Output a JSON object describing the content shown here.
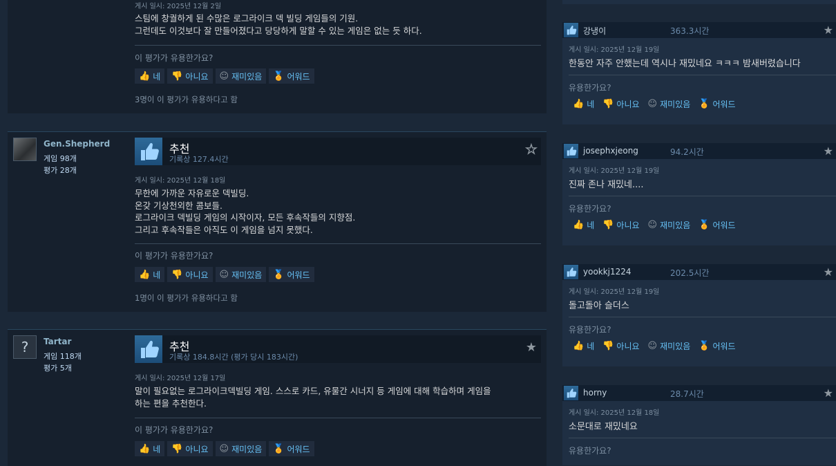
{
  "reviews": [
    {
      "posted": "게시 일시: 2025년 12월 2일",
      "body": [
        "스팀에 창궐하게 된 수많은 로그라이크 덱 빌딩 게임들의 기원.",
        "그런데도 이것보다 잘 만들어졌다고 당당하게 말할 수 있는 게임은 없는 듯 하다."
      ],
      "helpful_q": "이 평가가 유용한가요?",
      "buttons": {
        "yes": "네",
        "no": "아니요",
        "funny": "재미있음",
        "award": "어워드"
      },
      "helpful_count": "3명이 이 평가가 유용하다고 함"
    },
    {
      "author": {
        "name": "Gen.Shepherd",
        "games": "게임 98개",
        "reviews": "평가 28개"
      },
      "verdict": "추천",
      "hours": "기록상 127.4시간",
      "posted": "게시 일시: 2025년 12월 18일",
      "body": [
        "무한에 가까운 자유로운 덱빌딩.",
        "온갖 기상천외한 콤보들.",
        "로그라이크 덱빌딩 게임의 시작이자, 모든 후속작들의 지향점.",
        "그리고 후속작들은 아직도 이 게임을 넘지 못했다."
      ],
      "helpful_q": "이 평가가 유용한가요?",
      "buttons": {
        "yes": "네",
        "no": "아니요",
        "funny": "재미있음",
        "award": "어워드"
      },
      "helpful_count": "1명이 이 평가가 유용하다고 함"
    },
    {
      "author": {
        "name": "Tartar",
        "games": "게임 118개",
        "reviews": "평가 5개",
        "avatar_glyph": "?"
      },
      "verdict": "추천",
      "hours": "기록상 184.8시간 (평가 당시 183시간)",
      "posted": "게시 일시: 2025년 12월 17일",
      "body": [
        "말이 필요없는 로그라이크덱빌딩 게임. 스스로 카드, 유물간 시너지 등 게임에 대해 학습하며 게임을",
        "하는 편을 추천한다."
      ],
      "helpful_q": "이 평가가 유용한가요?",
      "buttons": {
        "yes": "네",
        "no": "아니요",
        "funny": "재미있음",
        "award": "어워드"
      }
    }
  ],
  "recent": [
    {
      "name": "강냉이",
      "hours": "363.3시간",
      "posted": "게시 일시: 2025년 12월 19일",
      "body": "한동안 자주 안했는데 역시나 재밌네요 ㅋㅋㅋ 밤새버렸습니다",
      "helpful_q": "유용한가요?",
      "buttons": {
        "yes": "네",
        "no": "아니요",
        "funny": "재미있음",
        "award": "어워드"
      }
    },
    {
      "name": "josephxjeong",
      "hours": "94.2시간",
      "posted": "게시 일시: 2025년 12월 19일",
      "body": "진짜 존나 재밌네....",
      "helpful_q": "유용한가요?",
      "buttons": {
        "yes": "네",
        "no": "아니요",
        "funny": "재미있음",
        "award": "어워드"
      }
    },
    {
      "name": "yookkj1224",
      "hours": "202.5시간",
      "posted": "게시 일시: 2025년 12월 19일",
      "body": "돌고돌아 슬더스",
      "helpful_q": "유용한가요?",
      "buttons": {
        "yes": "네",
        "no": "아니요",
        "funny": "재미있음",
        "award": "어워드"
      }
    },
    {
      "name": "horny",
      "hours": "28.7시간",
      "posted": "게시 일시: 2025년 12월 18일",
      "body": "소문대로 재밌네요",
      "helpful_q": "유용한가요?"
    }
  ],
  "icons": {
    "thumbs_up": "thumbs-up-icon",
    "thumbs_down": "thumbs-down-icon",
    "smile": "smile-icon",
    "award": "award-icon",
    "star": "star-icon"
  },
  "colors": {
    "accent": "#66c0f4",
    "award": "#f5c242",
    "background": "#1b2838"
  }
}
